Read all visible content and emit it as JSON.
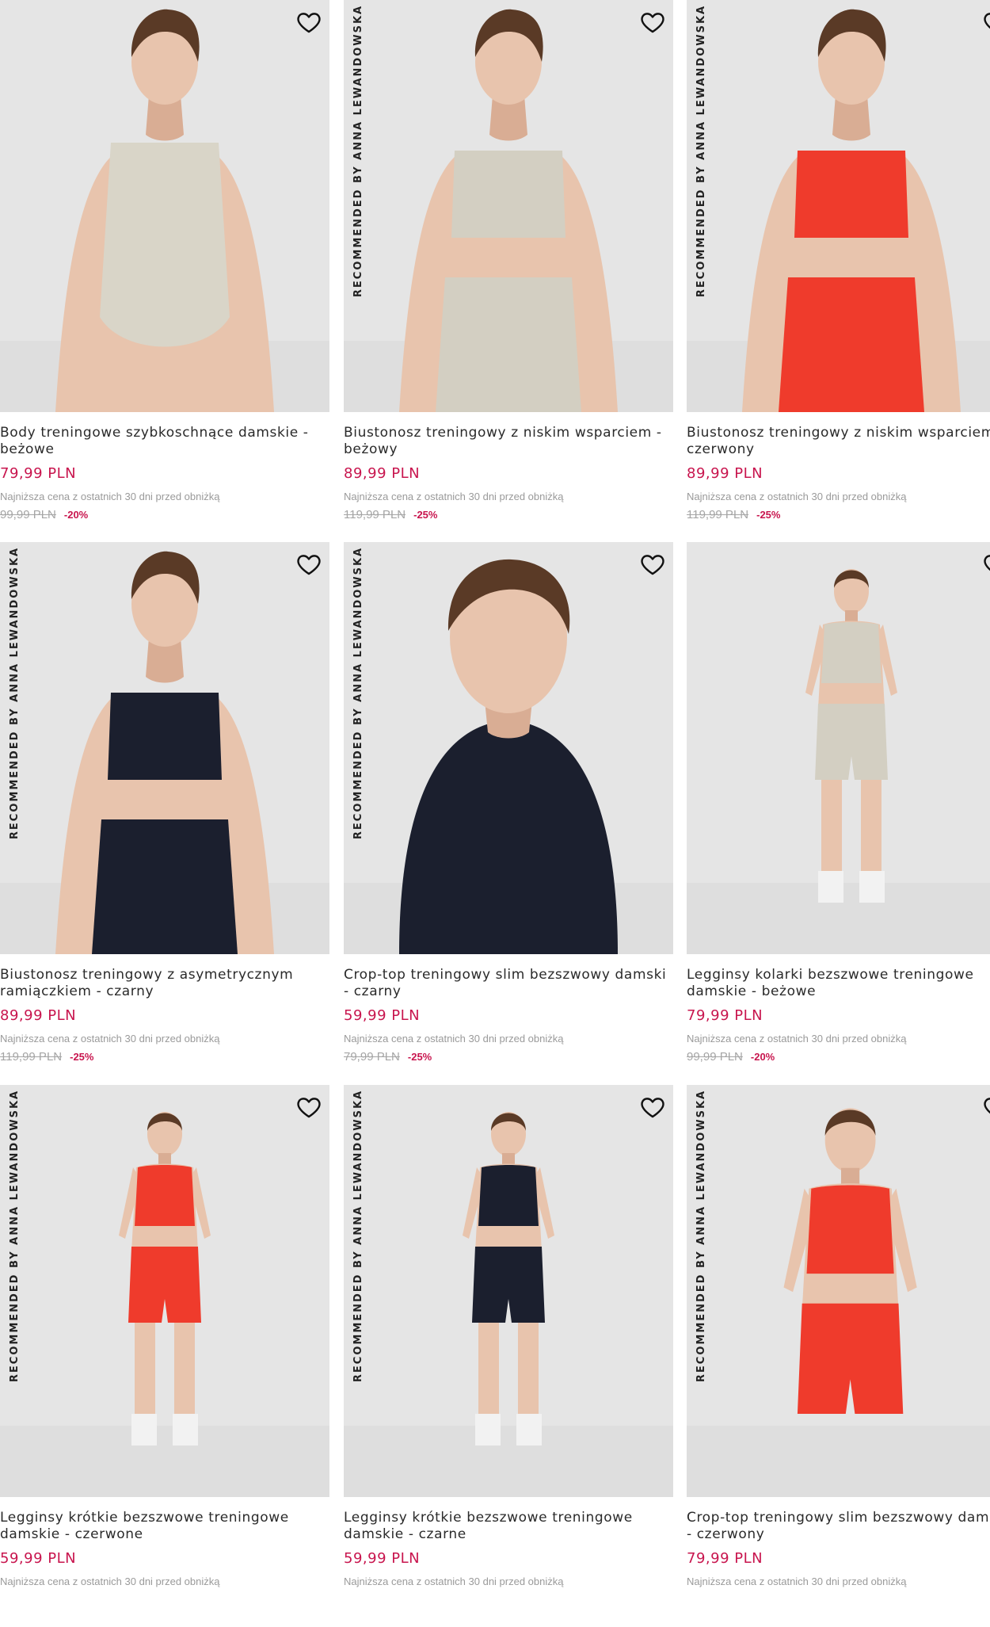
{
  "colors": {
    "price": "#c8154e",
    "discount": "#c8154e",
    "muted_text": "#9a9a9a",
    "image_background": "#e5e5e5"
  },
  "lowest_price_note": "Najniższa cena z ostatnich 30 dni przed obniżką",
  "products": [
    {
      "title": "Body treningowe szybkoschnące damskie - beżowe",
      "price": "79,99 PLN",
      "old_price": "99,99 PLN",
      "discount": "-20%",
      "ribbon": "",
      "has_favorite": true,
      "outfit": "bodysuit",
      "top_color": "#d9d5c8",
      "bottom_color": "#d9d5c8"
    },
    {
      "title": "Biustonosz treningowy z niskim wsparciem - beżowy",
      "price": "89,99 PLN",
      "old_price": "119,99 PLN",
      "discount": "-25%",
      "ribbon": "RECOMMENDED BY ANNA LEWANDOWSKA",
      "has_favorite": true,
      "outfit": "bra-leggings",
      "top_color": "#d3cfc2",
      "bottom_color": "#d3cfc2"
    },
    {
      "title": "Biustonosz treningowy z niskim wsparciem - czerwony",
      "price": "89,99 PLN",
      "old_price": "119,99 PLN",
      "discount": "-25%",
      "ribbon": "RECOMMENDED BY ANNA LEWANDOWSKA",
      "has_favorite": true,
      "outfit": "bra-leggings",
      "top_color": "#ef3b2c",
      "bottom_color": "#ef3b2c"
    },
    {
      "title": "Biustonosz treningowy z asymetrycznym ramiączkiem - czarny",
      "price": "89,99 PLN",
      "old_price": "119,99 PLN",
      "discount": "-25%",
      "ribbon": "RECOMMENDED BY ANNA LEWANDOWSKA",
      "has_favorite": true,
      "outfit": "bra-leggings",
      "top_color": "#1b1f2e",
      "bottom_color": "#1b1f2e"
    },
    {
      "title": "Crop-top treningowy slim bezszwowy damski - czarny",
      "price": "59,99 PLN",
      "old_price": "79,99 PLN",
      "discount": "-25%",
      "ribbon": "RECOMMENDED BY ANNA LEWANDOWSKA",
      "has_favorite": true,
      "outfit": "tee-closeup",
      "top_color": "#1b1f2e",
      "bottom_color": "#1b1f2e"
    },
    {
      "title": "Legginsy kolarki bezszwowe treningowe damskie - beżowe",
      "price": "79,99 PLN",
      "old_price": "99,99 PLN",
      "discount": "-20%",
      "ribbon": "",
      "has_favorite": true,
      "outfit": "full-shorts",
      "top_color": "#d3cfc2",
      "bottom_color": "#d3cfc2"
    },
    {
      "title": "Legginsy krótkie bezszwowe treningowe damskie - czerwone",
      "price": "59,99 PLN",
      "old_price": "",
      "discount": "",
      "ribbon": "RECOMMENDED BY ANNA LEWANDOWSKA",
      "has_favorite": true,
      "outfit": "full-shorts",
      "top_color": "#ef3b2c",
      "bottom_color": "#ef3b2c"
    },
    {
      "title": "Legginsy krótkie bezszwowe treningowe damskie - czarne",
      "price": "59,99 PLN",
      "old_price": "",
      "discount": "",
      "ribbon": "RECOMMENDED BY ANNA LEWANDOWSKA",
      "has_favorite": true,
      "outfit": "full-shorts",
      "top_color": "#1b1f2e",
      "bottom_color": "#1b1f2e"
    },
    {
      "title": "Crop-top treningowy slim bezszwowy damski - czerwony",
      "price": "79,99 PLN",
      "old_price": "",
      "discount": "",
      "ribbon": "RECOMMENDED BY ANNA LEWANDOWSKA",
      "has_favorite": true,
      "outfit": "halter-shorts",
      "top_color": "#ef3b2c",
      "bottom_color": "#ef3b2c"
    }
  ]
}
